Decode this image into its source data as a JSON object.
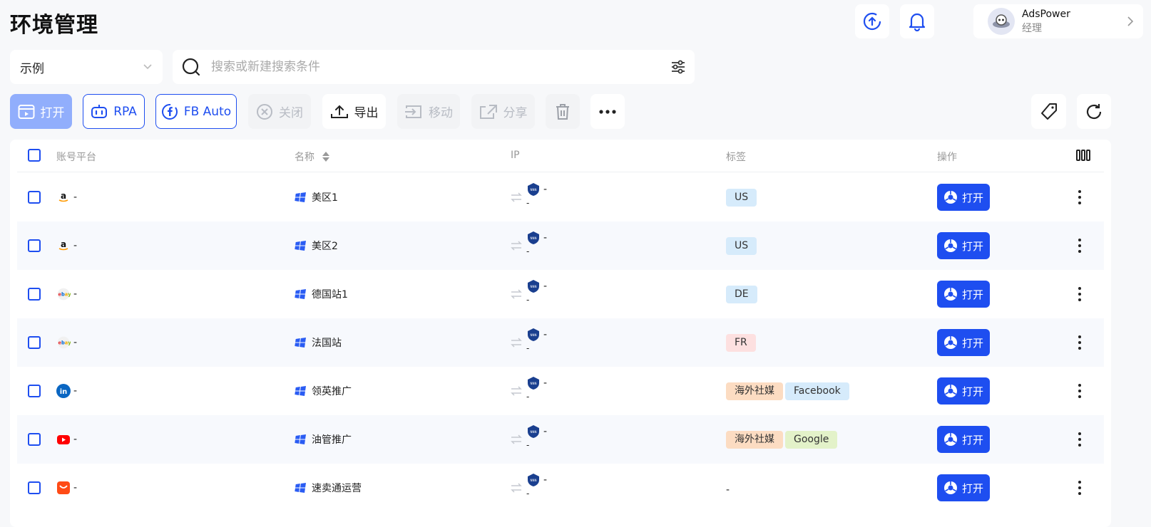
{
  "page": {
    "title": "环境管理"
  },
  "user": {
    "name": "AdsPower",
    "role": "经理"
  },
  "filter": {
    "group": "示例",
    "search_placeholder": "搜索或新建搜索条件"
  },
  "toolbar": {
    "open": "打开",
    "rpa": "RPA",
    "fb_auto": "FB Auto",
    "close": "关闭",
    "export": "导出",
    "move": "移动",
    "share": "分享"
  },
  "table": {
    "headers": {
      "platform": "账号平台",
      "name": "名称",
      "ip": "IP",
      "tags": "标签",
      "actions": "操作"
    },
    "rows": [
      {
        "platform": "amazon",
        "account": "-",
        "name": "美区1",
        "ip": "-",
        "ip_sub": "-",
        "tags": [
          {
            "text": "US",
            "color": "#d6ebfb"
          }
        ],
        "tags_empty": "",
        "open": "打开"
      },
      {
        "platform": "amazon",
        "account": "-",
        "name": "美区2",
        "ip": "-",
        "ip_sub": "-",
        "tags": [
          {
            "text": "US",
            "color": "#d6ebfb"
          }
        ],
        "tags_empty": "",
        "open": "打开"
      },
      {
        "platform": "ebay",
        "account": "-",
        "name": "德国站1",
        "ip": "-",
        "ip_sub": "-",
        "tags": [
          {
            "text": "DE",
            "color": "#d6ebfb"
          }
        ],
        "tags_empty": "",
        "open": "打开"
      },
      {
        "platform": "ebay",
        "account": "-",
        "name": "法国站",
        "ip": "-",
        "ip_sub": "-",
        "tags": [
          {
            "text": "FR",
            "color": "#fde0e0"
          }
        ],
        "tags_empty": "",
        "open": "打开"
      },
      {
        "platform": "linkedin",
        "account": "-",
        "name": "领英推广",
        "ip": "-",
        "ip_sub": "-",
        "tags": [
          {
            "text": "海外社媒",
            "color": "#fcdcc2"
          },
          {
            "text": "Facebook",
            "color": "#d6ebfb"
          }
        ],
        "tags_empty": "",
        "open": "打开"
      },
      {
        "platform": "youtube",
        "account": "-",
        "name": "油管推广",
        "ip": "-",
        "ip_sub": "-",
        "tags": [
          {
            "text": "海外社媒",
            "color": "#fcdcc2"
          },
          {
            "text": "Google",
            "color": "#e3f2c9"
          }
        ],
        "tags_empty": "",
        "open": "打开"
      },
      {
        "platform": "aliexpress",
        "account": "-",
        "name": "速卖通运营",
        "ip": "-",
        "ip_sub": "-",
        "tags": [],
        "tags_empty": "-",
        "open": "打开"
      }
    ]
  },
  "colors": {
    "accent": "#1e4ef0",
    "accent_light": "#91aefc",
    "background": "#f7f8fa"
  }
}
